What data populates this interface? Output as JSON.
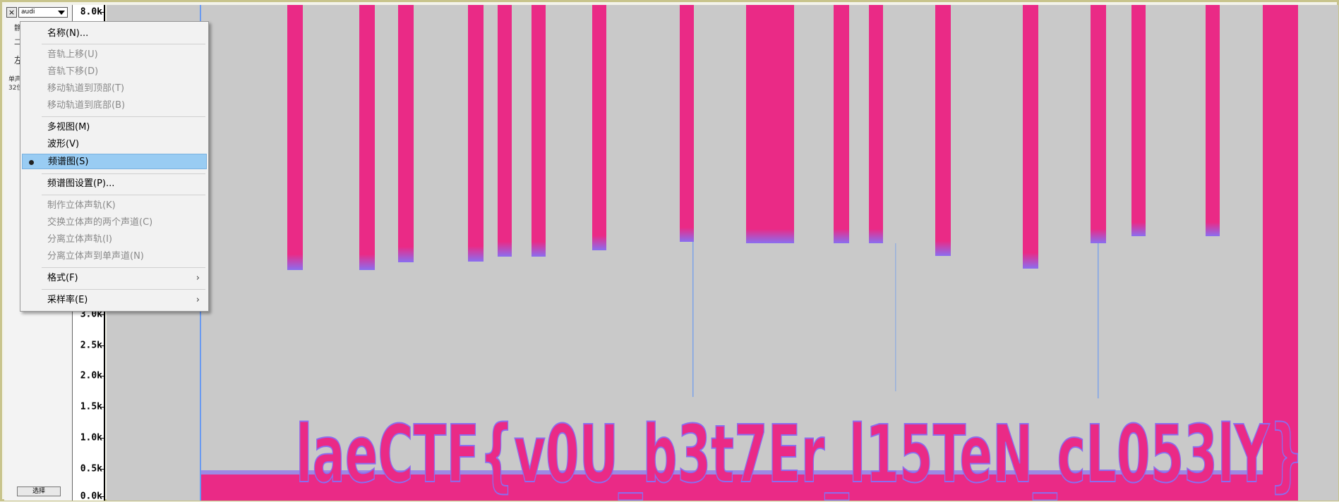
{
  "track": {
    "close_glyph": "×",
    "name": "audi",
    "stub_1": "静",
    "stub_2": "二",
    "stub_3": "左",
    "stub_4": "单声",
    "stub_5": "32位",
    "select_label": "选择"
  },
  "ruler": {
    "ticks": [
      "8.0k",
      "3.0k",
      "2.5k",
      "2.0k",
      "1.5k",
      "1.0k",
      "0.5k",
      "0.0k"
    ]
  },
  "spectrogram": {
    "background": "#c9c9c9",
    "bar_color": "#ea2a86",
    "edge_color": "#8a6ef0",
    "glow_color": "#6a9af0",
    "hidden_text": "laeCTF{v0U_b3t7Er_l15TeN_cL053lY}"
  },
  "menu": {
    "items": [
      {
        "label": "名称(N)...",
        "enabled": true
      },
      {
        "label": "音轨上移(U)",
        "enabled": false
      },
      {
        "label": "音轨下移(D)",
        "enabled": false
      },
      {
        "label": "移动轨道到顶部(T)",
        "enabled": false
      },
      {
        "label": "移动轨道到底部(B)",
        "enabled": false
      },
      {
        "label": "多视图(M)",
        "enabled": true
      },
      {
        "label": "波形(V)",
        "enabled": true
      },
      {
        "label": "频谱图(S)",
        "enabled": true,
        "selected": true
      },
      {
        "label": "频谱图设置(P)...",
        "enabled": true
      },
      {
        "label": "制作立体声轨(K)",
        "enabled": false
      },
      {
        "label": "交换立体声的两个声道(C)",
        "enabled": false
      },
      {
        "label": "分离立体声轨(I)",
        "enabled": false
      },
      {
        "label": "分离立体声到单声道(N)",
        "enabled": false
      },
      {
        "label": "格式(F)",
        "enabled": true,
        "submenu": true
      },
      {
        "label": "采样率(E)",
        "enabled": true,
        "submenu": true
      }
    ],
    "submenu_glyph": "›",
    "selected_color": "#99ccf3"
  }
}
